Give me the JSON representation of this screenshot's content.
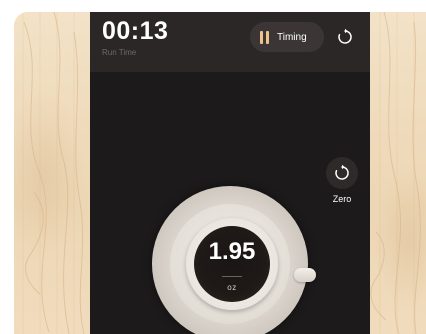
{
  "header": {
    "elapsed_time": "00:13",
    "elapsed_label": "Run Time",
    "timing_button_label": "Timing",
    "timing_icon": "pause-icon",
    "reset_icon": "reset-icon"
  },
  "scale": {
    "zero_label": "Zero",
    "zero_icon": "reset-icon",
    "weight_value": "1.95",
    "weight_unit": "oz"
  },
  "colors": {
    "background_panel": "#1c1a1a",
    "header_panel": "#2b2727",
    "accent": "#f2c28c"
  }
}
